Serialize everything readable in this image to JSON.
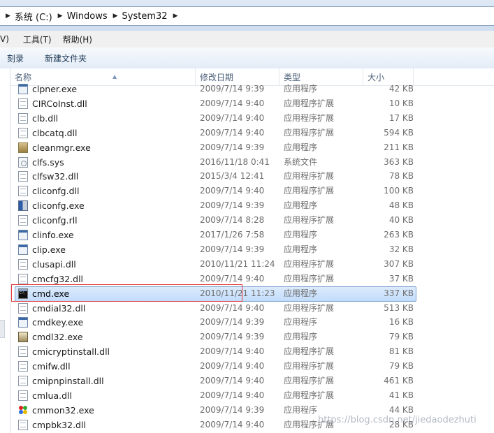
{
  "address": {
    "crumbs": [
      "系统 (C:)",
      "Windows",
      "System32"
    ]
  },
  "menu": [
    "V)",
    "工具(T)",
    "帮助(H)"
  ],
  "toolbar": {
    "burn_label": "刻录",
    "new_folder_label": "新建文件夹"
  },
  "columns": {
    "name": "名称",
    "date": "修改日期",
    "type": "类型",
    "size": "大小"
  },
  "files": [
    {
      "name": "clpner.exe",
      "date": "2009/7/14 9:39",
      "type": "应用程序",
      "size": "42 KB",
      "icon": "exe-icon"
    },
    {
      "name": "CIRCoInst.dll",
      "date": "2009/7/14 9:40",
      "type": "应用程序扩展",
      "size": "10 KB",
      "icon": "dll-icon"
    },
    {
      "name": "clb.dll",
      "date": "2009/7/14 9:40",
      "type": "应用程序扩展",
      "size": "17 KB",
      "icon": "dll-icon"
    },
    {
      "name": "clbcatq.dll",
      "date": "2009/7/14 9:40",
      "type": "应用程序扩展",
      "size": "594 KB",
      "icon": "dll-icon"
    },
    {
      "name": "cleanmgr.exe",
      "date": "2009/7/14 9:39",
      "type": "应用程序",
      "size": "211 KB",
      "icon": "cleanmgr-icon"
    },
    {
      "name": "clfs.sys",
      "date": "2016/11/18 0:41",
      "type": "系统文件",
      "size": "363 KB",
      "icon": "sys-icon"
    },
    {
      "name": "clfsw32.dll",
      "date": "2015/3/4 12:41",
      "type": "应用程序扩展",
      "size": "78 KB",
      "icon": "dll-icon"
    },
    {
      "name": "cliconfg.dll",
      "date": "2009/7/14 9:40",
      "type": "应用程序扩展",
      "size": "100 KB",
      "icon": "dll-icon"
    },
    {
      "name": "cliconfg.exe",
      "date": "2009/7/14 9:39",
      "type": "应用程序",
      "size": "48 KB",
      "icon": "cliconfg-icon"
    },
    {
      "name": "cliconfg.rll",
      "date": "2009/7/14 8:28",
      "type": "应用程序扩展",
      "size": "40 KB",
      "icon": "dll-icon"
    },
    {
      "name": "clinfo.exe",
      "date": "2017/1/26 7:58",
      "type": "应用程序",
      "size": "263 KB",
      "icon": "exe-icon"
    },
    {
      "name": "clip.exe",
      "date": "2009/7/14 9:39",
      "type": "应用程序",
      "size": "32 KB",
      "icon": "exe-icon"
    },
    {
      "name": "clusapi.dll",
      "date": "2010/11/21 11:24",
      "type": "应用程序扩展",
      "size": "307 KB",
      "icon": "dll-icon"
    },
    {
      "name": "cmcfg32.dll",
      "date": "2009/7/14 9:40",
      "type": "应用程序扩展",
      "size": "37 KB",
      "icon": "dll-icon"
    },
    {
      "name": "cmd.exe",
      "date": "2010/11/21 11:23",
      "type": "应用程序",
      "size": "337 KB",
      "icon": "cmd-icon",
      "selected": true
    },
    {
      "name": "cmdial32.dll",
      "date": "2009/7/14 9:40",
      "type": "应用程序扩展",
      "size": "513 KB",
      "icon": "dll-icon"
    },
    {
      "name": "cmdkey.exe",
      "date": "2009/7/14 9:39",
      "type": "应用程序",
      "size": "16 KB",
      "icon": "exe-icon"
    },
    {
      "name": "cmdl32.exe",
      "date": "2009/7/14 9:39",
      "type": "应用程序",
      "size": "79 KB",
      "icon": "cmdl-icon"
    },
    {
      "name": "cmicryptinstall.dll",
      "date": "2009/7/14 9:40",
      "type": "应用程序扩展",
      "size": "81 KB",
      "icon": "dll-icon"
    },
    {
      "name": "cmifw.dll",
      "date": "2009/7/14 9:40",
      "type": "应用程序扩展",
      "size": "79 KB",
      "icon": "dll-icon"
    },
    {
      "name": "cmipnpinstall.dll",
      "date": "2009/7/14 9:40",
      "type": "应用程序扩展",
      "size": "461 KB",
      "icon": "dll-icon"
    },
    {
      "name": "cmlua.dll",
      "date": "2009/7/14 9:40",
      "type": "应用程序扩展",
      "size": "41 KB",
      "icon": "dll-icon"
    },
    {
      "name": "cmmon32.exe",
      "date": "2009/7/14 9:39",
      "type": "应用程序",
      "size": "44 KB",
      "icon": "cmmon-icon"
    },
    {
      "name": "cmpbk32.dll",
      "date": "2009/7/14 9:40",
      "type": "应用程序扩展",
      "size": "28 KB",
      "icon": "dll-icon"
    }
  ],
  "watermark": "https://blog.csdn.net/jiedaodezhuti"
}
